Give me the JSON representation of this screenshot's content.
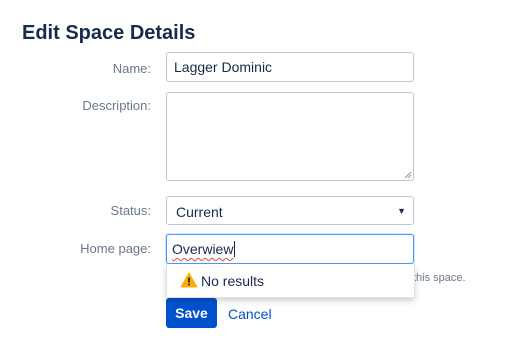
{
  "page": {
    "title": "Edit Space Details"
  },
  "form": {
    "name": {
      "label": "Name:",
      "value": "Lagger Dominic"
    },
    "description": {
      "label": "Description:",
      "value": ""
    },
    "status": {
      "label": "Status:",
      "selected": "Current"
    },
    "home_page": {
      "label": "Home page:",
      "value": "Overwiew",
      "help_text_visible": "this space."
    },
    "autocomplete": {
      "message": "No results",
      "icon": "warning-icon"
    }
  },
  "actions": {
    "save_label": "Save",
    "cancel_label": "Cancel"
  },
  "colors": {
    "primary": "#0052cc",
    "warning": "#ffab00",
    "focus_border": "#4c9aff",
    "label_text": "#6b778c"
  }
}
